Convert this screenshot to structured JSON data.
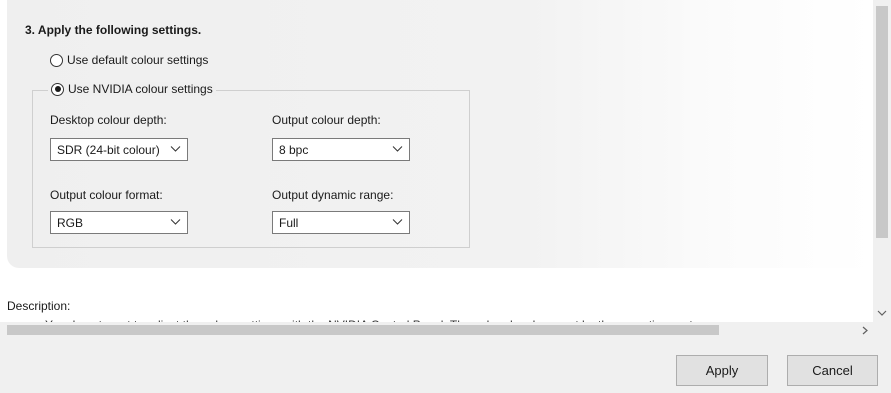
{
  "section": {
    "step_title": "3. Apply the following settings."
  },
  "colour_mode": {
    "default_label": "Use default colour settings",
    "default_selected": false,
    "nvidia_label": "Use NVIDIA colour settings",
    "nvidia_selected": true
  },
  "fields": {
    "desktop_depth": {
      "label": "Desktop colour depth:",
      "value": "SDR (24-bit colour)"
    },
    "output_depth": {
      "label": "Output colour depth:",
      "value": "8 bpc"
    },
    "output_format": {
      "label": "Output colour format:",
      "value": "RGB"
    },
    "dynamic_range": {
      "label": "Output dynamic range:",
      "value": "Full"
    }
  },
  "description": {
    "label": "Description:",
    "text": "You do not want to adjust the colour settings with the NVIDIA Control Panel. The colour has been set by the operating system."
  },
  "footer": {
    "apply_label": "Apply",
    "cancel_label": "Cancel"
  },
  "icons": {
    "dropdown": "chevron-down-icon",
    "scroll_down": "chevron-down-icon",
    "scroll_right": "chevron-right-icon"
  }
}
